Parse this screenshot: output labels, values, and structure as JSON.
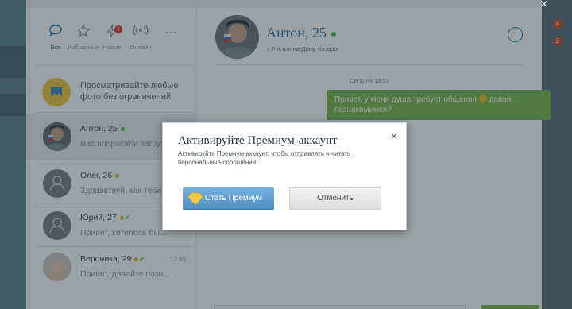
{
  "filters": [
    {
      "label": "Все",
      "icon": "chat-bubble-icon",
      "active": true
    },
    {
      "label": "Избранные",
      "icon": "star-icon"
    },
    {
      "label": "Новые",
      "icon": "lightning-icon",
      "badge": "1"
    },
    {
      "label": "Онлайн",
      "icon": "broadcast-icon"
    }
  ],
  "more_filters_label": "···",
  "promo": {
    "text": "Просматривайте любые фото без ограничений"
  },
  "chats": [
    {
      "name": "Антон, 25",
      "status": "online-green",
      "preview": "Вас попросили загрузит...",
      "time": ""
    },
    {
      "name": "Олег, 26",
      "status": "online-yellow",
      "preview": "Здравствуй, как тебе...",
      "time": ""
    },
    {
      "name": "Юрий, 27",
      "status": "online-yellow-read",
      "preview": "Привет, хотелось бы...",
      "time": ""
    },
    {
      "name": "Вероника, 29",
      "status": "online-yellow-read",
      "preview": "Привет, давайте позн...",
      "time": "12:49"
    }
  ],
  "peer": {
    "name": "Антон, 25",
    "location": "г. Ростов-на-Дону, Козерог"
  },
  "more_button": "···",
  "conversation": {
    "date": "Сегодня 18:51",
    "message_before": "Привет, у меня душа требует общения ",
    "message_after": " давай познакомимся?"
  },
  "bg_badges": [
    "4",
    "2"
  ],
  "window_close": "×",
  "modal": {
    "title": "Активируйте Премиум-аккаунт",
    "text": "Активируйте Премиум-аккаунт, чтобы отправлять и читать персональные сообщения.",
    "close": "×",
    "premium_button": "Стать Премиум",
    "cancel_button": "Отменить"
  },
  "colors": {
    "accent_blue": "#2d77b0",
    "online_green": "#52b748",
    "message_green": "#79b548",
    "badge_red": "#e0332d"
  }
}
